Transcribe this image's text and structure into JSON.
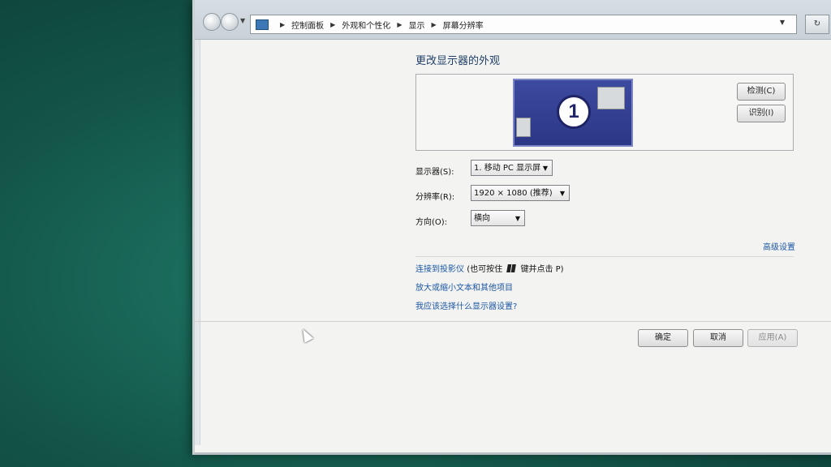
{
  "breadcrumb": [
    "控制面板",
    "外观和个性化",
    "显示",
    "屏幕分辨率"
  ],
  "heading": "更改显示器的外观",
  "preview": {
    "monitor_number": "1",
    "detect_label": "检测(C)",
    "identify_label": "识别(I)"
  },
  "settings": {
    "display_label": "显示器(S):",
    "display_value": "1. 移动 PC 显示屏",
    "resolution_label": "分辨率(R):",
    "resolution_value": "1920 × 1080 (推荐)",
    "orientation_label": "方向(O):",
    "orientation_value": "横向"
  },
  "advanced_link": "高级设置",
  "links": {
    "projector_link": "连接到投影仪",
    "projector_hint_pre": "(也可按住",
    "projector_hint_post": "键并点击 P)",
    "text_size_link": "放大或缩小文本和其他项目",
    "help_link": "我应该选择什么显示器设置?"
  },
  "footer": {
    "ok_label": "确定",
    "cancel_label": "取消",
    "apply_label": "应用(A)"
  },
  "colors": {
    "monitor_fill": "#3c4aa0",
    "link": "#1c57a6",
    "desktop": "#135548"
  }
}
